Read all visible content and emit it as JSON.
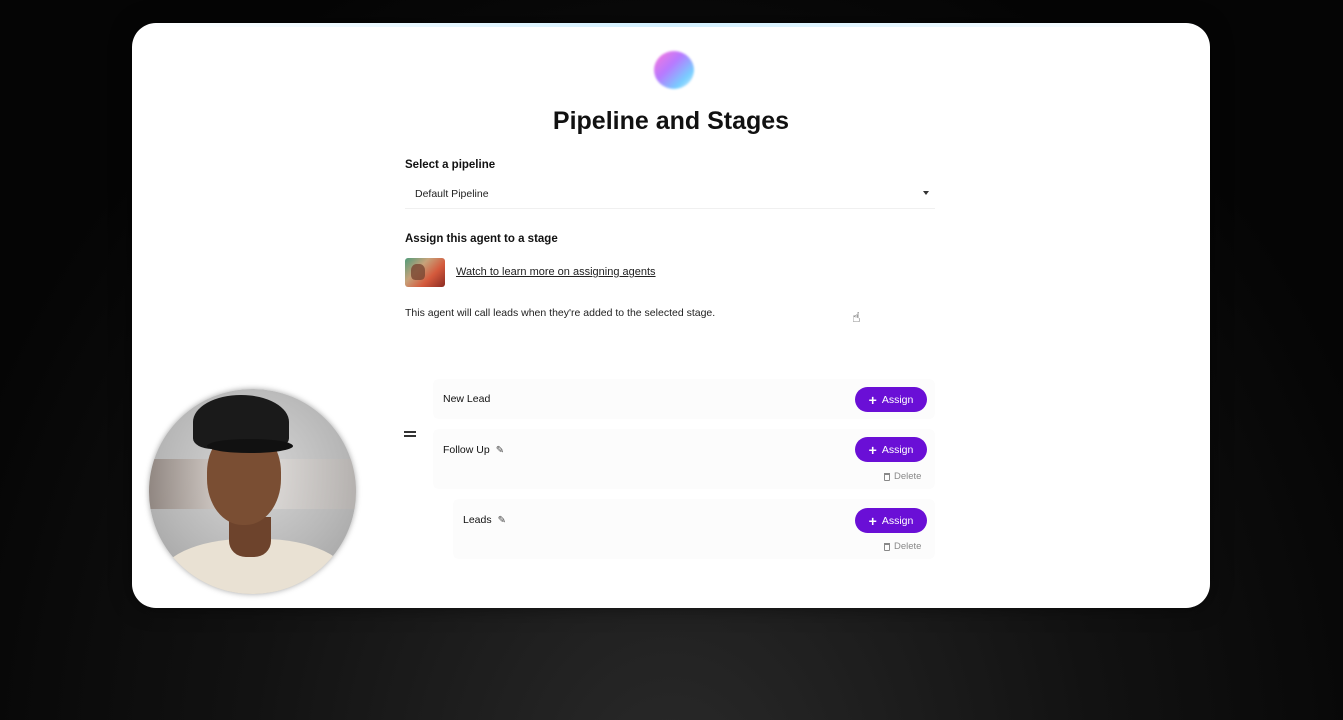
{
  "page": {
    "title": "Pipeline and Stages"
  },
  "pipeline": {
    "label": "Select a pipeline",
    "selected": "Default Pipeline"
  },
  "assign": {
    "label": "Assign this agent to a stage",
    "video_link": "Watch to learn more on assigning agents",
    "description": "This agent will call leads when they're added to the selected stage."
  },
  "stages": [
    {
      "name": "New Lead",
      "assign_label": "Assign",
      "editable": false,
      "deletable": false
    },
    {
      "name": "Follow Up",
      "assign_label": "Assign",
      "editable": true,
      "deletable": true,
      "delete_label": "Delete"
    },
    {
      "name": "Leads",
      "assign_label": "Assign",
      "editable": true,
      "deletable": true,
      "delete_label": "Delete"
    }
  ],
  "icons": {
    "logo": "gradient-orb-logo",
    "dropdown": "caret-down-icon",
    "edit": "pencil-icon",
    "add": "plus-icon",
    "delete": "trash-icon",
    "drag": "drag-handle-icon"
  },
  "colors": {
    "accent": "#6a0fd6",
    "background": "#000000",
    "card": "#ffffff"
  }
}
